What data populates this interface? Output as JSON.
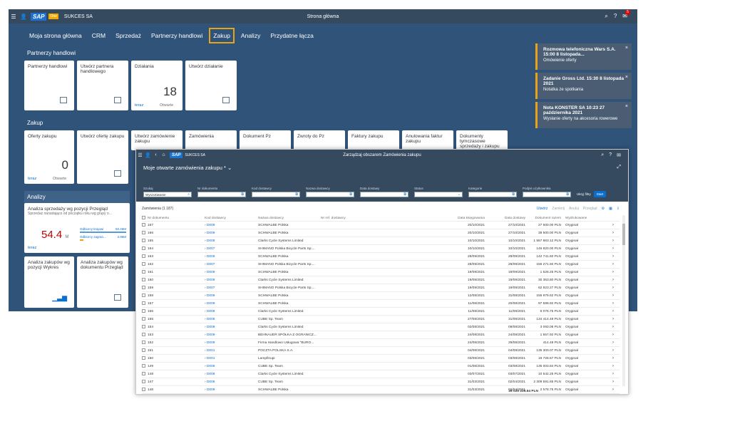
{
  "shell": {
    "company": "SUKCES SA",
    "title": "Strona główna",
    "badge": "5",
    "business_label": "Business",
    "one_label": "One"
  },
  "tabs": [
    "Moja strona główna",
    "CRM",
    "Sprzedaż",
    "Partnerzy handlowi",
    "Zakup",
    "Analizy",
    "Przydatne łącza"
  ],
  "sections": {
    "partners": "Partnerzy handlowi",
    "purchase": "Zakup",
    "analytics": "Analizy"
  },
  "partner_tiles": [
    {
      "title": "Partnerzy handlowi"
    },
    {
      "title": "Utwórz partnera handlowego"
    },
    {
      "title": "Działania",
      "count": "18",
      "foot": "teraz",
      "foot2": "Otwarte"
    },
    {
      "title": "Utwórz działanie"
    }
  ],
  "purchase_tiles": [
    {
      "title": "Oferty zakupu",
      "count": "0",
      "foot": "teraz",
      "foot2": "Otwarte"
    },
    {
      "title": "Utwórz ofertę zakupu"
    },
    {
      "title": "Utwórz zamówienie zakupu"
    },
    {
      "title": "Zamówienia"
    },
    {
      "title": "Dokument Pz"
    },
    {
      "title": "Zwroty do Pz"
    },
    {
      "title": "Faktury zakupu"
    },
    {
      "title": "Anulowania faktur zakupu"
    },
    {
      "title": "Dokumenty tymczasowe sprzedaży i zakupu"
    }
  ],
  "analytics": {
    "sales_tile_title": "Analiza sprzedaży wg pozycji Przegląd",
    "sales_tile_sub": "Sprzedaż narastająco od początku roku wg grupy o...",
    "value": "54.4",
    "unit": "M",
    "bar1_label": "Odbiorcy krajowi",
    "bar1_value": "50.45M",
    "bar2_label": "Odbiorcy zagran...",
    "bar2_value": "3.96M",
    "foot": "teraz",
    "tile2": "Analiza zakupów wg pozycji Wykres",
    "tile3": "Analiza zakupów wg dokumentu Przegląd"
  },
  "notifications": [
    {
      "title": "Rozmowa telefoniczna Wars S.A. 15:00 8 listopada...",
      "sub": "Omówienie oferty"
    },
    {
      "title": "Zadanie Gross Ltd. 15:30 8 listopada 2021",
      "sub": "Notatka ze spotkania"
    },
    {
      "title": "Nota KONSTER SA 10:23 27 października 2021",
      "sub": "Wysłanie oferty na akcesoria rowerowe"
    }
  ],
  "window": {
    "title": "Zarządzaj obszarem Zamówienia zakupu",
    "company": "SUKCES SA",
    "view": "Moje otwarte zamówienia zakupu *",
    "filters": [
      {
        "label": "Szukaj",
        "value": "Wyszukiwanie"
      },
      {
        "label": "Nr dokumentu",
        "value": ""
      },
      {
        "label": "Kod dostawcy",
        "value": ""
      },
      {
        "label": "Nazwa dostawcy",
        "value": ""
      },
      {
        "label": "Data dostawy",
        "value": ""
      },
      {
        "label": "Status",
        "value": ""
      },
      {
        "label": "Kategorie",
        "value": ""
      },
      {
        "label": "Podpis użytkownika",
        "value": ""
      }
    ],
    "hide_filters": "Ukryj filtry",
    "go": "Start",
    "count_label": "Zamówienia (1 187)",
    "toolbar": [
      "Utwórz",
      "Zamknij",
      "Anuluj",
      "Przegląd"
    ],
    "columns": [
      "Nr dokumentu",
      "Kod dostawcy",
      "Nazwa dostawcy",
      "Nr ref. dostawcy",
      "Data księgowania",
      "Data dostawy",
      "Dokument razem",
      "Wydrukowane"
    ],
    "rows": [
      [
        "167",
        "D009",
        "SCHWALBE Polska",
        "",
        "20/10/2021",
        "27/10/2021",
        "27 500.00 PLN",
        "Oryginał"
      ],
      [
        "166",
        "D009",
        "SCHWALBE Polska",
        "",
        "20/10/2021",
        "27/10/2021",
        "38 500.00 PLN",
        "Oryginał"
      ],
      [
        "165",
        "D008",
        "Clarks Cycle Systems Limited",
        "",
        "10/10/2021",
        "10/10/2021",
        "1 557 863.12 PLN",
        "Oryginał"
      ],
      [
        "164",
        "D007",
        "SHIMANO Polska Bicycle Parts Sp....",
        "",
        "10/10/2021",
        "10/10/2021",
        "146 820.00 PLN",
        "Oryginał"
      ],
      [
        "163",
        "D009",
        "SCHWALBE Polska",
        "",
        "28/09/2021",
        "28/09/2021",
        "142 741.50 PLN",
        "Oryginał"
      ],
      [
        "162",
        "D007",
        "SHIMANO Polska Bicycle Parts Sp....",
        "",
        "28/09/2021",
        "28/09/2021",
        "156 271.50 PLN",
        "Oryginał"
      ],
      [
        "161",
        "D009",
        "SCHWALBE Polska",
        "",
        "19/09/2021",
        "19/09/2021",
        "1 526.25 PLN",
        "Oryginał"
      ],
      [
        "160",
        "D008",
        "Clarks Cycle Systems Limited",
        "",
        "19/09/2021",
        "19/09/2021",
        "30 363.80 PLN",
        "Oryginał"
      ],
      [
        "159",
        "D007",
        "SHIMANO Polska Bicycle Parts Sp....",
        "",
        "19/09/2021",
        "19/09/2021",
        "62 823.27 PLN",
        "Oryginał"
      ],
      [
        "158",
        "D009",
        "SCHWALBE Polska",
        "",
        "12/08/2021",
        "31/08/2021",
        "156 979.62 PLN",
        "Oryginał"
      ],
      [
        "157",
        "D009",
        "SCHWALBE Polska",
        "",
        "11/08/2021",
        "20/08/2021",
        "97 598.92 PLN",
        "Oryginał"
      ],
      [
        "156",
        "D008",
        "Clarks Cycle Systems Limited",
        "",
        "11/08/2021",
        "11/08/2021",
        "6 076.75 PLN",
        "Oryginał"
      ],
      [
        "155",
        "D006",
        "CUBE Sp. Team",
        "",
        "27/08/2021",
        "31/08/2021",
        "134 414.48 PLN",
        "Oryginał"
      ],
      [
        "154",
        "D008",
        "Clarks Cycle Systems Limited",
        "",
        "02/08/2021",
        "09/08/2021",
        "3 093.08 PLN",
        "Oryginał"
      ],
      [
        "153",
        "D009",
        "BEHNAUER SPÓŁKA Z OGRANICZ...",
        "",
        "24/08/2021",
        "24/08/2021",
        "1 557.92 PLN",
        "Oryginał"
      ],
      [
        "152",
        "D009",
        "Firma Handlowo Usługowa \"BURO...",
        "",
        "24/08/2021",
        "29/08/2021",
        "414.48 PLN",
        "Oryginał"
      ],
      [
        "151",
        "D001",
        "POCZTA POLSKA S.A.",
        "",
        "04/08/2021",
        "04/08/2021",
        "135 300.07 PLN",
        "Oryginał"
      ],
      [
        "150",
        "D001",
        "Lampfinupi",
        "",
        "03/08/2021",
        "03/08/2021",
        "16 728.57 PLN",
        "Oryginał"
      ],
      [
        "149",
        "D006",
        "CUBE Sp. Team",
        "",
        "01/08/2021",
        "03/08/2021",
        "135 003.84 PLN",
        "Oryginał"
      ],
      [
        "148",
        "D008",
        "Clarks Cycle Systems Limited",
        "",
        "03/07/2021",
        "03/07/2021",
        "10 542.25 PLN",
        "Oryginał"
      ],
      [
        "147",
        "D006",
        "CUBE Sp. Team",
        "",
        "31/03/2021",
        "02/04/2021",
        "2 309 591.65 PLN",
        "Oryginał"
      ],
      [
        "146",
        "D009",
        "SCHWALBE Polska",
        "",
        "31/03/2021",
        "02/04/2021",
        "2 578.75 PLN",
        "Oryginał"
      ]
    ],
    "total": "26 020 225.64 PLN"
  }
}
